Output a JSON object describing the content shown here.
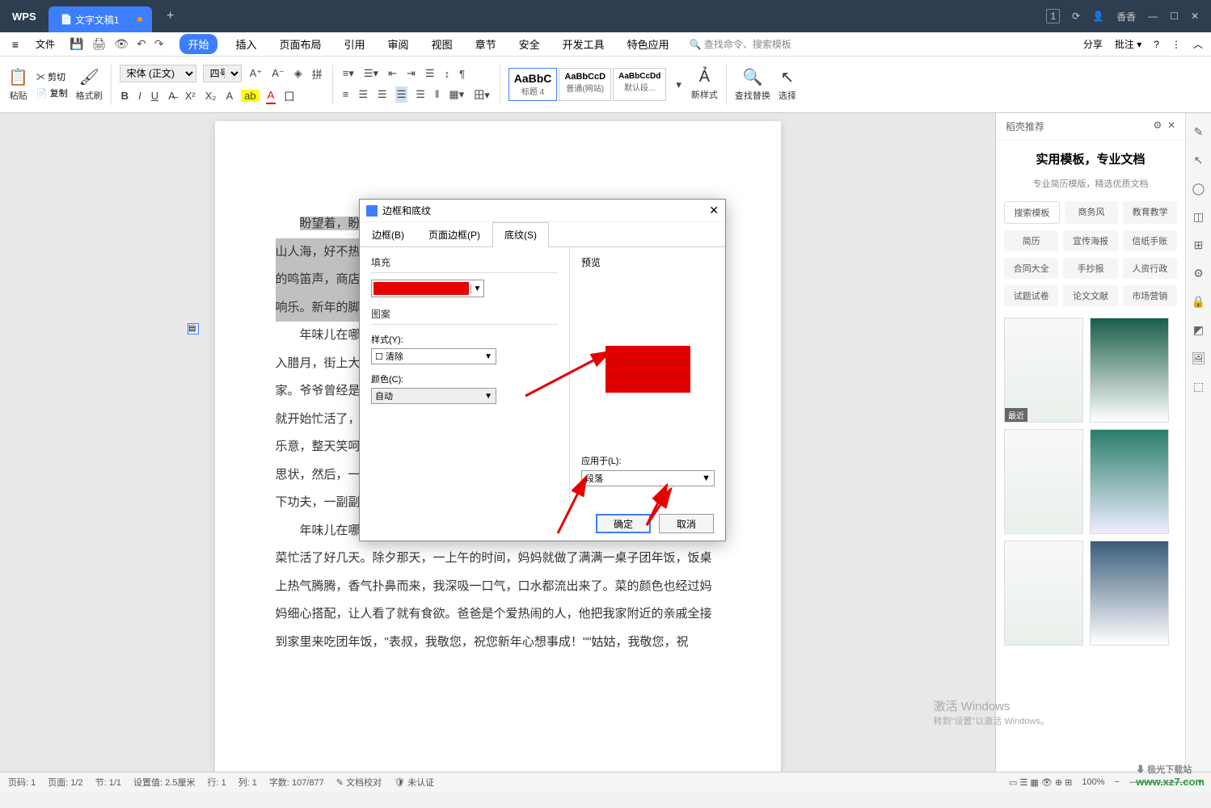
{
  "titlebar": {
    "logo": "WPS",
    "tab_name": "文字文稿1",
    "newtab": "+",
    "user": "香香",
    "badge": "1"
  },
  "menubar": {
    "file": "文件",
    "tabs": [
      "开始",
      "插入",
      "页面布局",
      "引用",
      "审阅",
      "视图",
      "章节",
      "安全",
      "开发工具",
      "特色应用"
    ],
    "active_tab": 0,
    "search": "查找命令、搜索模板",
    "share": "分享",
    "annotate": "批注"
  },
  "ribbon": {
    "paste": "粘贴",
    "cut": "剪切",
    "copy": "复制",
    "formatpainter": "格式刷",
    "font_name": "宋体 (正文)",
    "font_size": "四号",
    "styles": [
      {
        "preview": "AaBbC",
        "label": "标题 4"
      },
      {
        "preview": "AaBbCcD",
        "label": "普通(网站)"
      },
      {
        "preview": "AaBbCcDd",
        "label": "默认段..."
      }
    ],
    "newstyle": "新样式",
    "findreplace": "查找替换",
    "select": "选择"
  },
  "document": {
    "paragraphs": [
      "盼望着，盼望着，",
      "山人海，好不热闹。眼",
      "的鸣笛声，商店的叫卖",
      "响乐。新年的脚步近",
      "年味儿在哪里？哦",
      "入腊月，街上大街小巷",
      "家。爷爷曾经是语文老",
      "就开始忙活了，亲戚朋",
      "乐意，整天笑呵呵的忙",
      "思状，然后，一手按纸",
      "下功夫，一副副对联就",
      "年味儿在哪里？哦，年味儿在一桌桌喷喷的菜肴里。腊月底，妈妈为过年的饭菜忙活了好几天。除夕那天，一上午的时间，妈妈就做了满满一桌子团年饭，饭桌上热气腾腾，香气扑鼻而来，我深吸一口气，口水都流出来了。菜的颜色也经过妈妈细心搭配，让人看了就有食欲。爸爸是个爱热闹的人，他把我家附近的亲戚全接到家里来吃团年饭，\"表叔，我敬您，祝您新年心想事成！\"\"姑姑，我敬您，祝"
    ]
  },
  "dialog": {
    "title": "边框和底纹",
    "tabs": [
      "边框(B)",
      "页面边框(P)",
      "底纹(S)"
    ],
    "active_tab": 2,
    "fill_label": "填充",
    "pattern_label": "图案",
    "style_label": "样式(Y):",
    "style_value": "清除",
    "color_label": "颜色(C):",
    "color_value": "自动",
    "preview_label": "预览",
    "apply_label": "应用于(L):",
    "apply_value": "段落",
    "ok": "确定",
    "cancel": "取消"
  },
  "sidepanel": {
    "header": "稻壳推荐",
    "title": "实用模板，专业文档",
    "subtitle": "专业简历模版，精选优质文档",
    "search_placeholder": "搜索模板",
    "tags_row1": [
      "商务风",
      "教育教学"
    ],
    "tags_row2": [
      "简历",
      "宣传海报",
      "信纸手账"
    ],
    "tags_row3": [
      "合同大全",
      "手抄报",
      "人资行政"
    ],
    "tags_row4": [
      "试题试卷",
      "论文文献",
      "市场营销"
    ],
    "recent_badge": "最近"
  },
  "statusbar": {
    "page": "页码: 1",
    "pages": "页面: 1/2",
    "section": "节: 1/1",
    "setvalue": "设置值: 2.5厘米",
    "line": "行: 1",
    "col": "列: 1",
    "words": "字数: 107/877",
    "proof": "文档校对",
    "verify": "未认证",
    "zoom": "100%"
  },
  "watermark": {
    "win_title": "激活 Windows",
    "win_sub": "转到\"设置\"以激活 Windows。",
    "site_cn": "极光下载站",
    "site_url": "www.xz7.com"
  }
}
